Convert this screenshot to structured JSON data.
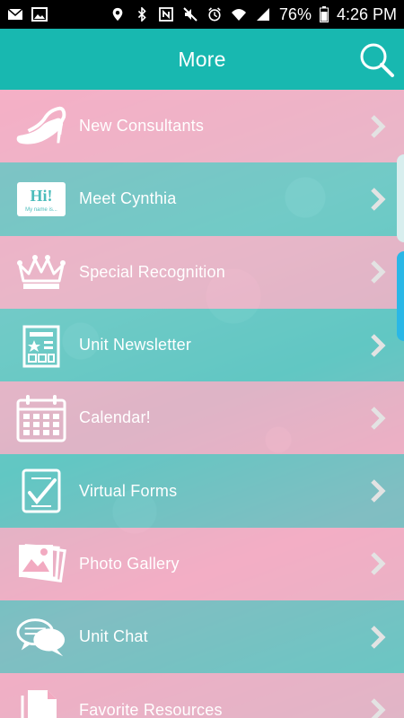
{
  "status_bar": {
    "battery": "76%",
    "time": "4:26 PM",
    "icons": [
      "mail-icon",
      "image-icon",
      "location-icon",
      "bluetooth-icon",
      "nfc-icon",
      "mute-icon",
      "alarm-icon",
      "wifi-icon",
      "signal-icon",
      "battery-icon"
    ]
  },
  "header": {
    "title": "More",
    "search_icon": "search-icon"
  },
  "menu": {
    "items": [
      {
        "label": "New Consultants",
        "icon": "high-heels-icon"
      },
      {
        "label": "Meet Cynthia",
        "icon": "hi-name-tag-icon"
      },
      {
        "label": "Special Recognition",
        "icon": "crown-icon"
      },
      {
        "label": "Unit Newsletter",
        "icon": "newspaper-icon"
      },
      {
        "label": "Calendar!",
        "icon": "calendar-icon"
      },
      {
        "label": "Virtual Forms",
        "icon": "checklist-icon"
      },
      {
        "label": "Photo Gallery",
        "icon": "photo-gallery-icon"
      },
      {
        "label": "Unit Chat",
        "icon": "chat-bubbles-icon"
      },
      {
        "label": "Favorite Resources",
        "icon": "document-icon"
      }
    ],
    "hi_tag_text": "Hi!",
    "hi_tag_sub": "My name is..."
  },
  "colors": {
    "header": "#18b8b0",
    "row_pink": "#f5aec6",
    "row_teal": "#54c4c2",
    "side_tab": "#2ab7e6"
  }
}
